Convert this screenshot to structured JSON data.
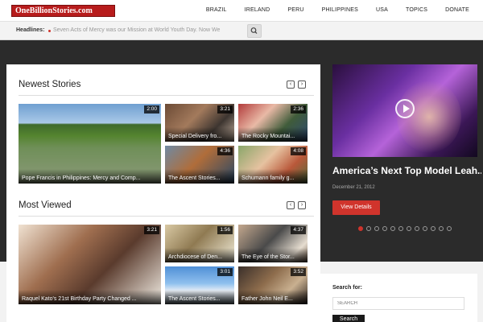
{
  "header": {
    "logo_text": "OneBillionStories.com",
    "nav": [
      "BRAZIL",
      "IRELAND",
      "PERU",
      "PHILIPPINES",
      "USA",
      "TOPICS",
      "DONATE"
    ],
    "headlines_label": "Headlines:",
    "headline_text": "Seven Acts of Mercy was our Mission at World Youth Day. Now We"
  },
  "newest": {
    "title": "Newest Stories",
    "prev": "‹",
    "next": "›",
    "items": [
      {
        "caption": "Pope Francis in Philippines: Mercy and Comp...",
        "duration": "2:00",
        "icon": "rice-terraces"
      },
      {
        "caption": "Special Delivery fro...",
        "duration": "3:21",
        "icon": "room"
      },
      {
        "caption": "The Rocky Mountai...",
        "duration": "2:36",
        "icon": "mountain"
      },
      {
        "caption": "The Ascent Stories...",
        "duration": "4:36",
        "icon": "sled"
      },
      {
        "caption": "Schumann family g...",
        "duration": "4:08",
        "icon": "family"
      }
    ]
  },
  "most_viewed": {
    "title": "Most Viewed",
    "prev": "‹",
    "next": "›",
    "items": [
      {
        "caption": "Raquel Kato's 21st Birthday Party Changed ...",
        "duration": "3:21",
        "icon": "baby"
      },
      {
        "caption": "Archdiocese of Den...",
        "duration": "1:56",
        "icon": "cathedral"
      },
      {
        "caption": "The Eye of the Stor...",
        "duration": "4:37",
        "icon": "eye"
      },
      {
        "caption": "The Ascent Stories...",
        "duration": "3:01",
        "icon": "sky"
      },
      {
        "caption": "Father John Neil E...",
        "duration": "3:52",
        "icon": "priest"
      }
    ]
  },
  "featured": {
    "title": "America’s Next Top Model Leah...",
    "date": "December 21, 2012",
    "button": "View Details",
    "dot_count": 12,
    "active_dot": 0,
    "accent": "#d0342c"
  },
  "search": {
    "label": "Search for:",
    "placeholder": "SEARCH",
    "button": "Search"
  }
}
